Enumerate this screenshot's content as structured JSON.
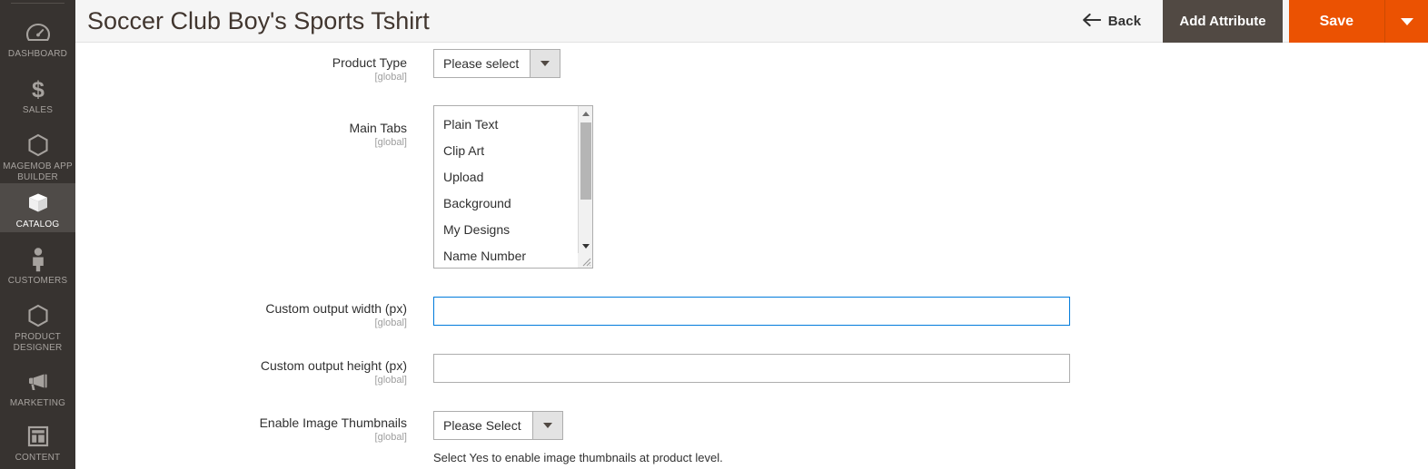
{
  "sidebar": {
    "items": [
      {
        "label": "Dashboard",
        "icon": "dashboard-icon",
        "active": false
      },
      {
        "label": "Sales",
        "icon": "dollar-icon",
        "active": false
      },
      {
        "label": "MageMob App Builder",
        "icon": "hexagon-icon",
        "active": false
      },
      {
        "label": "Catalog",
        "icon": "box-icon",
        "active": true
      },
      {
        "label": "Customers",
        "icon": "person-icon",
        "active": false
      },
      {
        "label": "Product Designer",
        "icon": "hexagon-icon",
        "active": false
      },
      {
        "label": "Marketing",
        "icon": "megaphone-icon",
        "active": false
      },
      {
        "label": "Content",
        "icon": "layout-icon",
        "active": false
      }
    ]
  },
  "header": {
    "title": "Soccer Club Boy's Sports Tshirt",
    "back_label": "Back",
    "back_icon": "arrow-left-icon",
    "add_attribute_label": "Add Attribute",
    "save_label": "Save",
    "save_dropdown_icon": "chevron-down-icon"
  },
  "colors": {
    "sidebar_bg": "#373330",
    "sidebar_active_bg": "#4f4b48",
    "header_bg": "#f5f5f5",
    "primary_action": "#eb5202",
    "secondary_action": "#514943",
    "focus_border": "#007bdb",
    "label_text": "#303030",
    "scope_text": "#9e9e9e"
  },
  "form": {
    "scope_label": "[global]",
    "fields": [
      {
        "label": "Product Type",
        "scope": "[global]",
        "type": "select",
        "value": "Please select"
      },
      {
        "label": "Main Tabs",
        "scope": "[global]",
        "type": "multiselect",
        "options": [
          "Plain Text",
          "Clip Art",
          "Upload",
          "Background",
          "My Designs",
          "Name Number"
        ]
      },
      {
        "label": "Custom output width (px)",
        "scope": "[global]",
        "type": "text",
        "value": "",
        "placeholder": "",
        "focused": true
      },
      {
        "label": "Custom output height (px)",
        "scope": "[global]",
        "type": "text",
        "value": "",
        "placeholder": "",
        "focused": false
      },
      {
        "label": "Enable Image Thumbnails",
        "scope": "[global]",
        "type": "select",
        "value": "Please Select",
        "note": "Select Yes to enable image thumbnails at product level."
      }
    ]
  }
}
